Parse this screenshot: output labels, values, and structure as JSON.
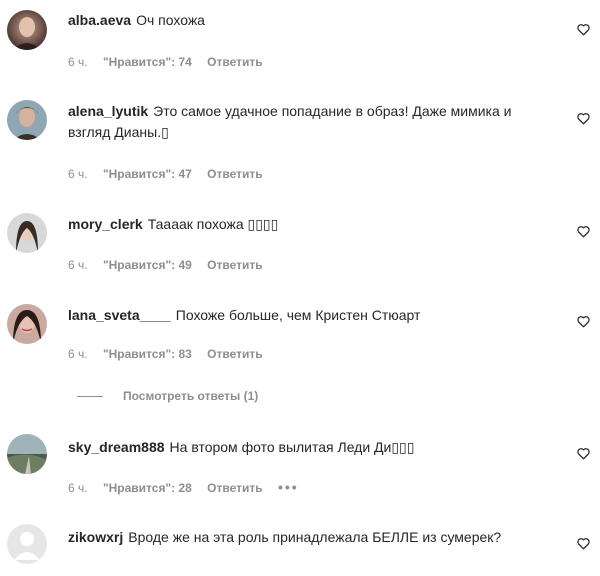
{
  "comments": [
    {
      "username": "alba.aeva",
      "text": "Оч похожа",
      "time": "6 ч.",
      "likes": "\"Нравится\": 74",
      "reply": "Ответить"
    },
    {
      "username": "alena_lyutik",
      "text": "Это самое удачное попадание в образ! Даже мимика и взгляд Дианы.▯",
      "time": "6 ч.",
      "likes": "\"Нравится\": 47",
      "reply": "Ответить"
    },
    {
      "username": "mory_clerk",
      "text": "Тааaак похожа ▯▯▯▯",
      "time": "6 ч.",
      "likes": "\"Нравится\": 49",
      "reply": "Ответить"
    },
    {
      "username": "lana_sveta____",
      "text": "Похоже больше, чем Кристен Стюарт",
      "time": "6 ч.",
      "likes": "\"Нравится\": 83",
      "reply": "Ответить"
    },
    {
      "username": "sky_dream888",
      "text": "На втором фото вылитая Леди Ди▯▯▯",
      "time": "6 ч.",
      "likes": "\"Нравится\": 28",
      "reply": "Ответить",
      "more": "•••"
    },
    {
      "username": "zikowxrj",
      "text": "Вроде же на эта роль принадлежала БЕЛЛЕ из сумерек?"
    }
  ],
  "view_replies": "Посмотреть ответы (1)",
  "icons": {
    "like": "heart-outline-icon",
    "more": "more-dots-icon",
    "avatar_default": "default-avatar-icon"
  }
}
